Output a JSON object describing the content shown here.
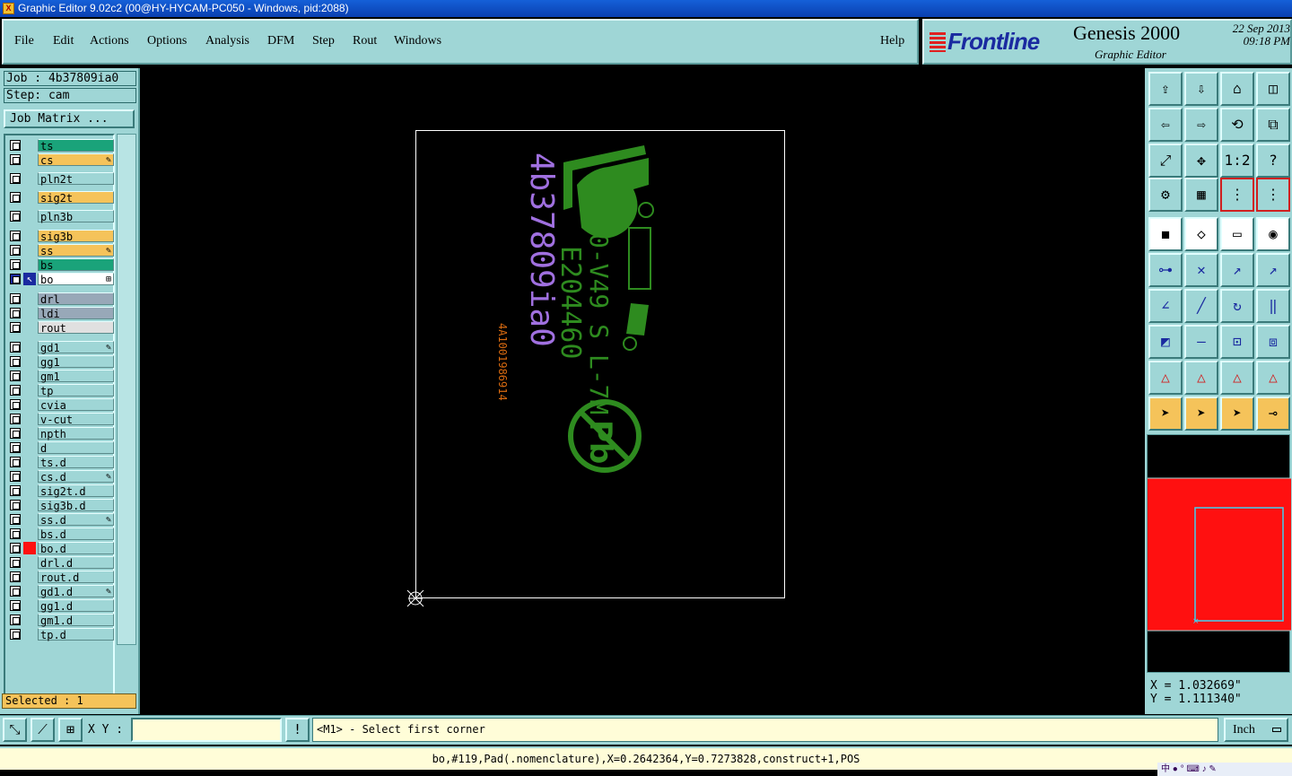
{
  "window": {
    "title": "Graphic Editor 9.02c2 (00@HY-HYCAM-PC050 - Windows, pid:2088)"
  },
  "menu": {
    "file": "File",
    "edit": "Edit",
    "actions": "Actions",
    "options": "Options",
    "analysis": "Analysis",
    "dfm": "DFM",
    "step": "Step",
    "rout": "Rout",
    "windows": "Windows",
    "help": "Help"
  },
  "brand": {
    "logo": "Frontline",
    "product": "Genesis 2000",
    "subtitle": "Graphic Editor",
    "date": "22 Sep 2013",
    "time": "09:18 PM"
  },
  "job": {
    "job_line": "Job : 4b37809ia0",
    "step_line": "Step: cam",
    "matrix_button": "Job Matrix ..."
  },
  "layers": [
    {
      "name": "ts",
      "color": "#1aa37a",
      "mark": "",
      "edit": ""
    },
    {
      "name": "cs",
      "color": "#f5c35a",
      "mark": "",
      "edit": "✎"
    },
    {
      "name": "pln2t",
      "color": "#9fd6d6",
      "mark": "",
      "edit": ""
    },
    {
      "name": "sig2t",
      "color": "#f5c35a",
      "mark": "",
      "edit": ""
    },
    {
      "name": "pln3b",
      "color": "#9fd6d6",
      "mark": "",
      "edit": ""
    },
    {
      "name": "sig3b",
      "color": "#f5c35a",
      "mark": "",
      "edit": ""
    },
    {
      "name": "ss",
      "color": "#f5c35a",
      "mark": "",
      "edit": "✎"
    },
    {
      "name": "bs",
      "color": "#1aa37a",
      "mark": "",
      "edit": ""
    },
    {
      "name": "bo",
      "color": "#ffffff",
      "mark": "work",
      "edit": "⊞"
    },
    {
      "name": "drl",
      "color": "#98a8b8",
      "mark": "",
      "edit": ""
    },
    {
      "name": "ldi",
      "color": "#98a8b8",
      "mark": "",
      "edit": ""
    },
    {
      "name": "rout",
      "color": "#e0e0e0",
      "mark": "",
      "edit": ""
    },
    {
      "name": "gd1",
      "color": "#9fd6d6",
      "mark": "",
      "edit": "✎"
    },
    {
      "name": "gg1",
      "color": "#9fd6d6",
      "mark": "",
      "edit": ""
    },
    {
      "name": "gm1",
      "color": "#9fd6d6",
      "mark": "",
      "edit": ""
    },
    {
      "name": "tp",
      "color": "#9fd6d6",
      "mark": "",
      "edit": ""
    },
    {
      "name": "cvia",
      "color": "#9fd6d6",
      "mark": "",
      "edit": ""
    },
    {
      "name": "v-cut",
      "color": "#9fd6d6",
      "mark": "",
      "edit": ""
    },
    {
      "name": "npth",
      "color": "#9fd6d6",
      "mark": "",
      "edit": ""
    },
    {
      "name": "d",
      "color": "#9fd6d6",
      "mark": "",
      "edit": ""
    },
    {
      "name": "ts.d",
      "color": "#9fd6d6",
      "mark": "",
      "edit": ""
    },
    {
      "name": "cs.d",
      "color": "#9fd6d6",
      "mark": "",
      "edit": "✎"
    },
    {
      "name": "sig2t.d",
      "color": "#9fd6d6",
      "mark": "",
      "edit": ""
    },
    {
      "name": "sig3b.d",
      "color": "#9fd6d6",
      "mark": "",
      "edit": ""
    },
    {
      "name": "ss.d",
      "color": "#9fd6d6",
      "mark": "",
      "edit": "✎"
    },
    {
      "name": "bs.d",
      "color": "#9fd6d6",
      "mark": "",
      "edit": ""
    },
    {
      "name": "bo.d",
      "color": "#9fd6d6",
      "mark": "red",
      "edit": ""
    },
    {
      "name": "drl.d",
      "color": "#9fd6d6",
      "mark": "",
      "edit": ""
    },
    {
      "name": "rout.d",
      "color": "#9fd6d6",
      "mark": "",
      "edit": ""
    },
    {
      "name": "gd1.d",
      "color": "#9fd6d6",
      "mark": "",
      "edit": "✎"
    },
    {
      "name": "gg1.d",
      "color": "#9fd6d6",
      "mark": "",
      "edit": ""
    },
    {
      "name": "gm1.d",
      "color": "#9fd6d6",
      "mark": "",
      "edit": ""
    },
    {
      "name": "tp.d",
      "color": "#9fd6d6",
      "mark": "",
      "edit": ""
    }
  ],
  "selected": "Selected : 1",
  "canvas": {
    "job_text": "4b37809ia0",
    "code_text": "E204460",
    "rating_text": "0-V49 S L-7M",
    "small_text": "4A1001986914",
    "logo_text": "Pb",
    "trace_color": "#2e8b1f",
    "text_color": "#a070e0"
  },
  "coords": {
    "x": "X = 1.032669\"",
    "y": "Y = 1.111340\""
  },
  "bottom": {
    "xy_label": "X Y :",
    "xy_value": "",
    "prompt": "<M1> - Select first corner",
    "unit": "Inch"
  },
  "status": "bo,#119,Pad(.nomenclature),X=0.2642364,Y=0.7273828,construct+1,POS",
  "tray": "中 ● ° ⌨ ♪ ✎",
  "toolbar_rows": [
    [
      "⇪",
      "⇩",
      "⌂",
      "◫"
    ],
    [
      "⇦",
      "⇨",
      "⟲",
      "⧉"
    ],
    [
      "⤢",
      "✥",
      "1:2",
      "?"
    ],
    [
      "⚙",
      "▦",
      "⋮",
      "⋮"
    ],
    [
      "◼",
      "◇",
      "▭",
      "◉"
    ],
    [
      "⊶",
      "✕",
      "↗",
      "↗"
    ],
    [
      "∠",
      "╱",
      "↻",
      "‖"
    ],
    [
      "◩",
      "—",
      "⊡",
      "⧈"
    ],
    [
      "△",
      "△",
      "△",
      "△"
    ],
    [
      "➤",
      "➤",
      "➤",
      "⊸"
    ]
  ]
}
